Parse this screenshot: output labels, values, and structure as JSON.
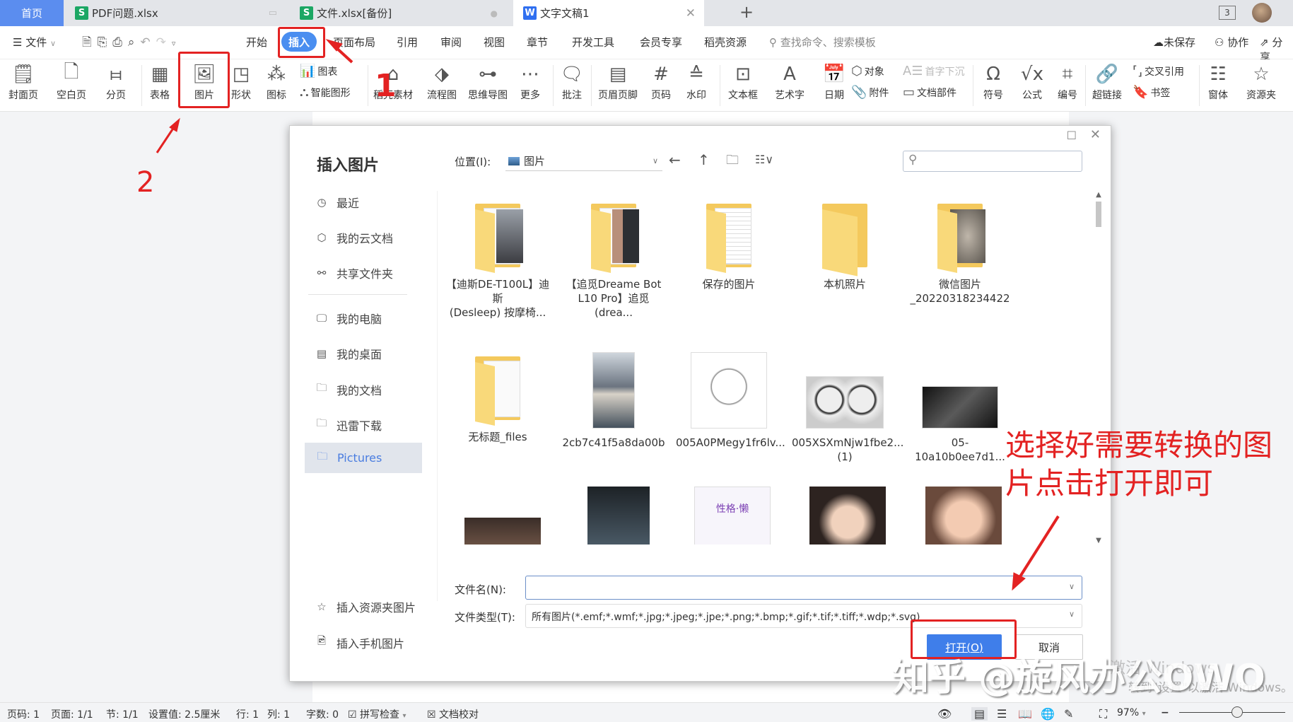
{
  "tabs": [
    {
      "label": "首页",
      "type": "home"
    },
    {
      "label": "PDF问题.xlsx",
      "icon": "S",
      "icon_color": "#1ca764"
    },
    {
      "label": "文件.xlsx[备份]",
      "icon": "S",
      "icon_color": "#1ca764"
    },
    {
      "label": "文字文稿1",
      "icon": "W",
      "icon_color": "#2f6ff0",
      "active": true
    }
  ],
  "window": {
    "tab_count": "3"
  },
  "menu": {
    "file": "文件",
    "items": [
      "开始",
      "插入",
      "页面布局",
      "引用",
      "审阅",
      "视图",
      "章节",
      "开发工具",
      "会员专享",
      "稻壳资源"
    ],
    "active": "插入",
    "search_placeholder": "查找命令、搜索模板",
    "unsaved": "未保存",
    "collab": "协作",
    "share": "分享"
  },
  "ribbon": {
    "cover": "封面页",
    "blank": "空白页",
    "pagebreak": "分页",
    "table": "表格",
    "picture": "图片",
    "shape": "形状",
    "icons": "图标",
    "chart": "图表",
    "smart": "智能图形",
    "docer": "稻壳素材",
    "flow": "流程图",
    "mind": "思维导图",
    "more": "更多",
    "comment": "批注",
    "header": "页眉页脚",
    "pagenum": "页码",
    "watermark": "水印",
    "textbox": "文本框",
    "arttext": "艺术字",
    "date": "日期",
    "object": "对象",
    "dropcap": "首字下沉",
    "attach": "附件",
    "docpart": "文档部件",
    "symbol": "符号",
    "formula": "公式",
    "numbering": "编号",
    "hyperlink": "超链接",
    "crossref": "交叉引用",
    "bookmark": "书签",
    "window": "窗体",
    "resource": "资源夹"
  },
  "dialog": {
    "title": "插入图片",
    "location_label": "位置(I):",
    "location_value": "图片",
    "search_placeholder": "",
    "nav": [
      {
        "label": "最近",
        "icon": "clock"
      },
      {
        "label": "我的云文档",
        "icon": "cloud-doc"
      },
      {
        "label": "共享文件夹",
        "icon": "share"
      },
      {
        "label": "我的电脑",
        "icon": "computer"
      },
      {
        "label": "我的桌面",
        "icon": "desktop"
      },
      {
        "label": "我的文档",
        "icon": "folder"
      },
      {
        "label": "迅雷下载",
        "icon": "folder"
      },
      {
        "label": "Pictures",
        "icon": "folder",
        "selected": true
      }
    ],
    "nav_bottom": [
      {
        "label": "插入资源夹图片"
      },
      {
        "label": "插入手机图片"
      }
    ],
    "files": [
      {
        "name_line1": "【迪斯DE-T100L】迪斯",
        "name_line2": "(Desleep) 按摩椅...",
        "type": "folder"
      },
      {
        "name_line1": "【追觅Dreame Bot",
        "name_line2": "L10 Pro】追觅(drea...",
        "type": "folder"
      },
      {
        "name_line1": "保存的图片",
        "name_line2": "",
        "type": "folder"
      },
      {
        "name_line1": "本机照片",
        "name_line2": "",
        "type": "folder"
      },
      {
        "name_line1": "微信图片",
        "name_line2": "_20220318234422",
        "type": "folder"
      },
      {
        "name_line1": "无标题_files",
        "name_line2": "",
        "type": "folder"
      },
      {
        "name_line1": "2cb7c41f5a8da00b",
        "name_line2": "",
        "type": "image"
      },
      {
        "name_line1": "005A0PMegy1fr6lv...",
        "name_line2": "",
        "type": "image"
      },
      {
        "name_line1": "005XSXmNjw1fbe2...",
        "name_line2": "(1)",
        "type": "image"
      },
      {
        "name_line1": "05-10a10b0ee7d1...",
        "name_line2": "",
        "type": "image"
      }
    ],
    "row3_thumb_caption": "性格·懒",
    "filename_label": "文件名(N):",
    "filename_value": "",
    "filetype_label": "文件类型(T):",
    "filetype_value": "所有图片(*.emf;*.wmf;*.jpg;*.jpeg;*.jpe;*.png;*.bmp;*.gif;*.tif;*.tiff;*.wdp;*.svg)",
    "open": "打开(O)",
    "cancel": "取消"
  },
  "annotations": {
    "step1": "1",
    "step2": "2",
    "instruction_line1": "选择好需要转换的图",
    "instruction_line2": "片点击打开即可",
    "watermark": "知乎 @旋风办公OWO",
    "activate_line1": "激活 Windows",
    "activate_line2": "转到\"设置\"以激活 Windows。"
  },
  "status": {
    "page": "页码: 1",
    "pages": "页面: 1/1",
    "section": "节: 1/1",
    "setting": "设置值: 2.5厘米",
    "row": "行: 1",
    "col": "列: 1",
    "words": "字数: 0",
    "spell": "拼写检查",
    "proof": "文档校对",
    "zoom": "97%"
  },
  "colors": {
    "accent": "#4a8ef0",
    "annotation": "#e32222",
    "selected_nav": "#e1e5ec"
  }
}
